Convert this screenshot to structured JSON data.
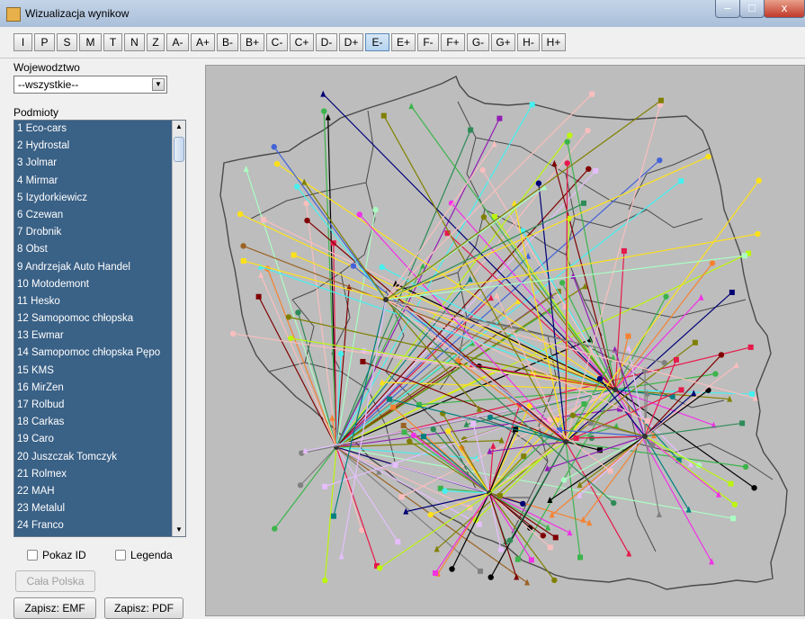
{
  "window": {
    "title": "Wizualizacja wynikow",
    "minimize": "–",
    "maximize": "□",
    "close": "x"
  },
  "toolbar": {
    "buttons": [
      "I",
      "P",
      "S",
      "M",
      "T",
      "N",
      "Z",
      "A-",
      "A+",
      "B-",
      "B+",
      "C-",
      "C+",
      "D-",
      "D+",
      "E-",
      "E+",
      "F-",
      "F+",
      "G-",
      "G+",
      "H-",
      "H+"
    ],
    "selected": "E-"
  },
  "sidebar": {
    "voivodeship_label": "Wojewodztwo",
    "voivodeship_value": "--wszystkie--",
    "entities_label": "Podmioty",
    "entities": [
      "1 Eco-cars",
      "2 Hydrostal",
      "3 Jolmar",
      "4 Mirmar",
      "5 Izydorkiewicz",
      "6 Czewan",
      "7 Drobnik",
      "8 Obst",
      "9 Andrzejak Auto  Handel",
      "10 Motodemont",
      "11 Hesko",
      "12 Samopomoc chłopska",
      "13 Ewmar",
      "14 Samopomoc chłopska Pępo",
      "15 KMS",
      "16 MirZen",
      "17 Rolbud",
      "18 Carkas",
      "19 Caro",
      "20 Juszczak Tomczyk",
      "21 Rolmex",
      "22 MAH",
      "23 Metalul",
      "24 Franco"
    ],
    "show_id_label": "Pokaz ID",
    "legend_label": "Legenda",
    "whole_poland_label": "Cała Polska",
    "save_emf_label": "Zapisz: EMF",
    "save_pdf_label": "Zapisz: PDF"
  },
  "map": {
    "background": "#bdbdbd",
    "border_color": "#4a4a4a",
    "series_colors": [
      "#e6194b",
      "#3cb44b",
      "#ffe119",
      "#4363d8",
      "#f58231",
      "#911eb4",
      "#46f0f0",
      "#f032e6",
      "#bcf60c",
      "#fabebe",
      "#008080",
      "#e6beff",
      "#9a6324",
      "#800000",
      "#aaffc3",
      "#808000",
      "#000075",
      "#808080",
      "#000000",
      "#2e8b57"
    ]
  }
}
